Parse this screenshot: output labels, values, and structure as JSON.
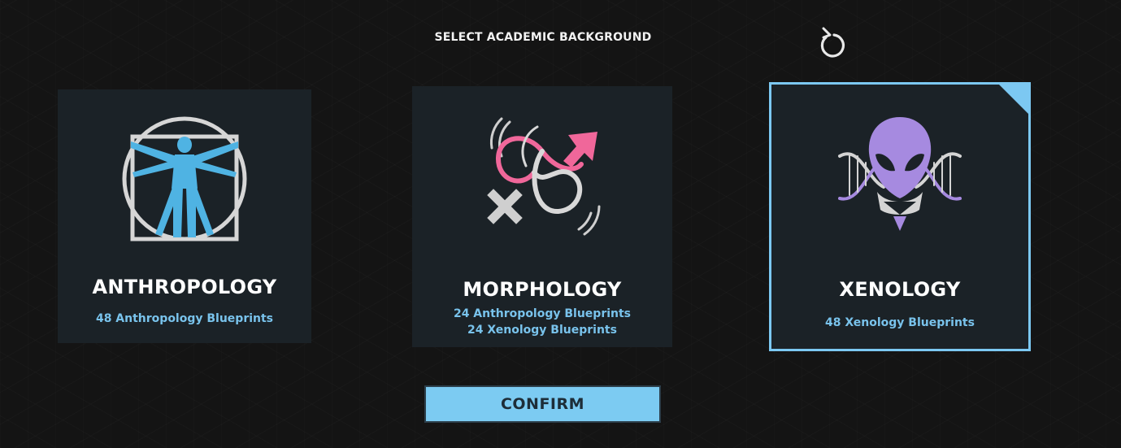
{
  "header": {
    "title": "SELECT ACADEMIC BACKGROUND",
    "refresh_icon": "refresh-icon"
  },
  "cards": [
    {
      "name": "ANTHROPOLOGY",
      "blueprints": [
        "48 Anthropology Blueprints"
      ],
      "icon": "vitruvian-man-icon",
      "selected": false
    },
    {
      "name": "MORPHOLOGY",
      "blueprints": [
        "24 Anthropology Blueprints",
        "24 Xenology Blueprints"
      ],
      "icon": "gender-symbols-icon",
      "selected": false
    },
    {
      "name": "XENOLOGY",
      "blueprints": [
        "48 Xenology Blueprints"
      ],
      "icon": "alien-dna-icon",
      "selected": true
    }
  ],
  "confirm_label": "CONFIRM",
  "colors": {
    "accent": "#7cc8f2",
    "anthropology_icon": "#4fb3e3",
    "morphology_pink": "#f0679a",
    "xenology_purple": "#a68ae0",
    "card_bg": "#1b2227"
  }
}
